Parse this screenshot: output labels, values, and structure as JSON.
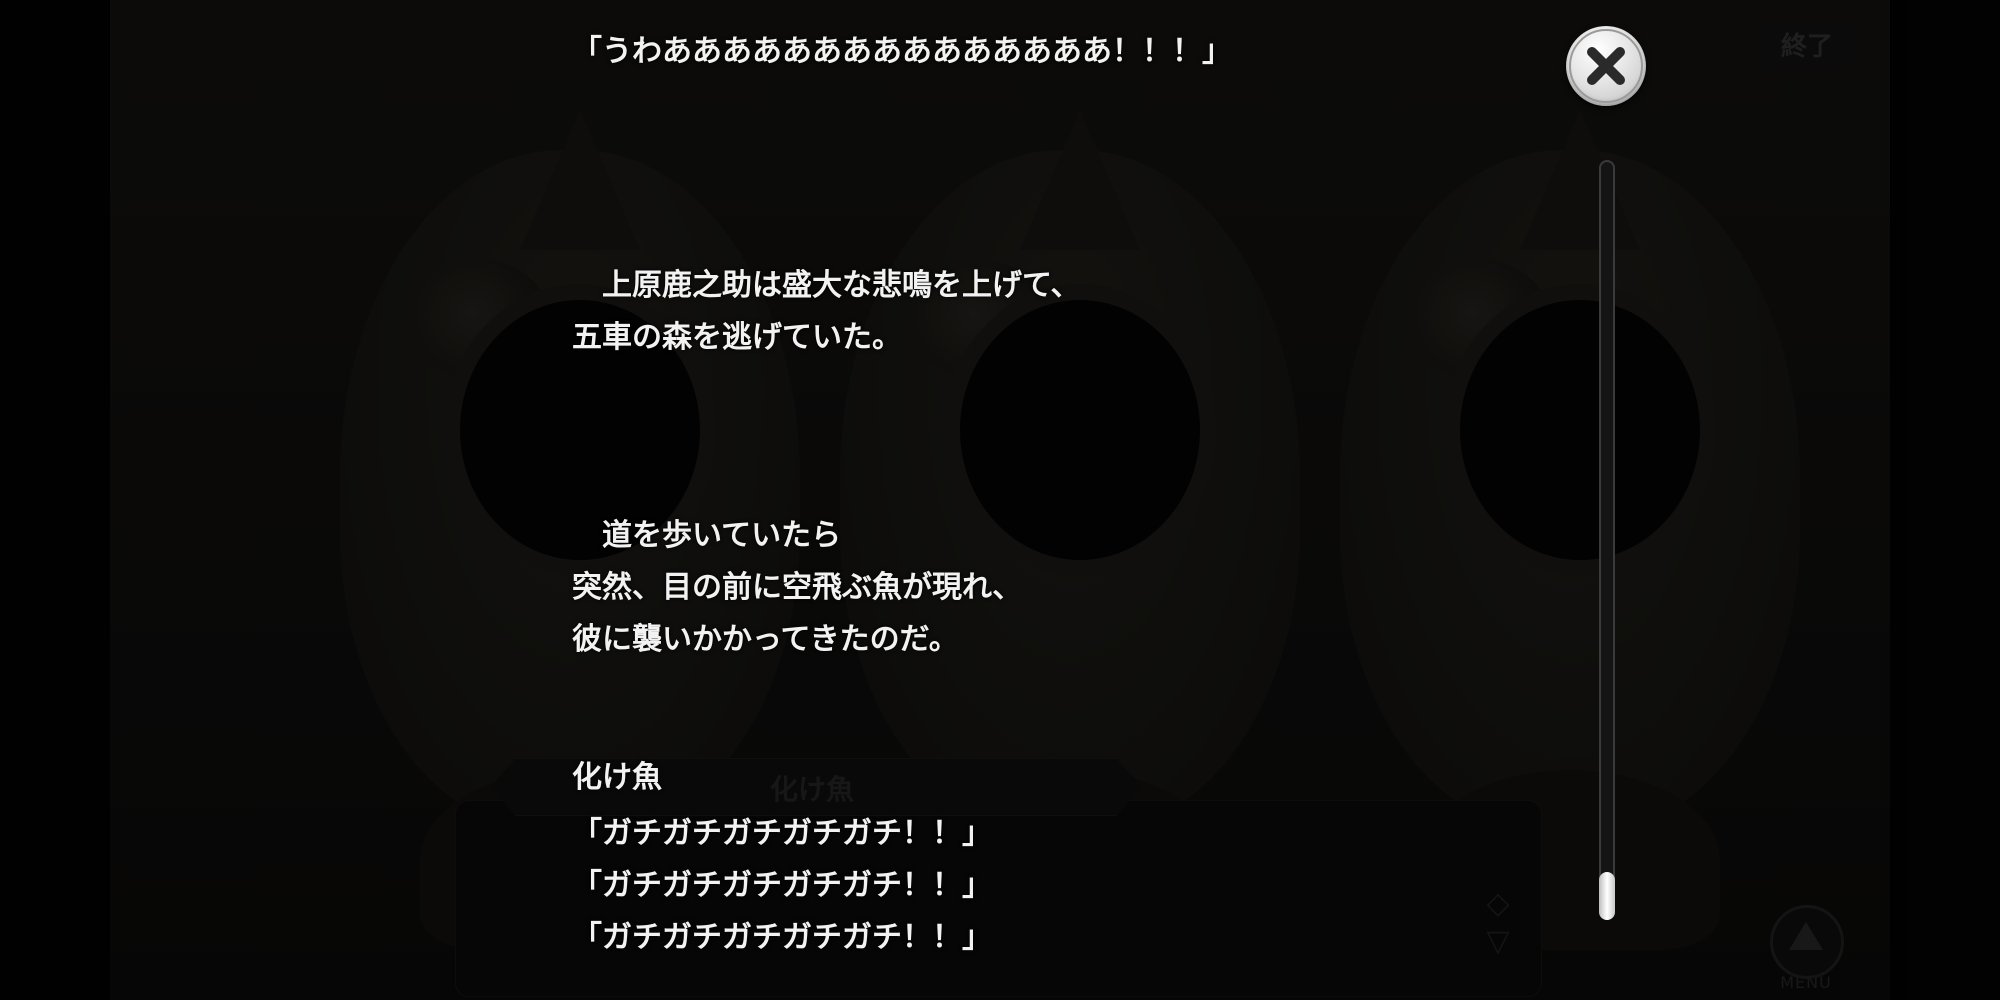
{
  "background": {
    "end_label": "終了",
    "menu_label": "MENU",
    "speaker_name_ghost": "化け魚"
  },
  "log": {
    "entries": [
      {
        "text": "「うわあああああああああああああああ！！！」"
      },
      {
        "text": "　上原鹿之助は盛大な悲鳴を上げて、\n五車の森を逃げていた。"
      },
      {
        "text": "　道を歩いていたら\n突然、目の前に空飛ぶ魚が現れ、\n彼に襲いかかってきたのだ。"
      },
      {
        "speaker": "化け魚",
        "text": "「ガチガチガチガチガチ！！」\n「ガチガチガチガチガチ！！」\n「ガチガチガチガチガチ！！」"
      }
    ],
    "scroll_position": 1.0
  },
  "icons": {
    "close": "close-icon",
    "menu": "triangle-up-icon",
    "auto": "arrows-icon"
  }
}
